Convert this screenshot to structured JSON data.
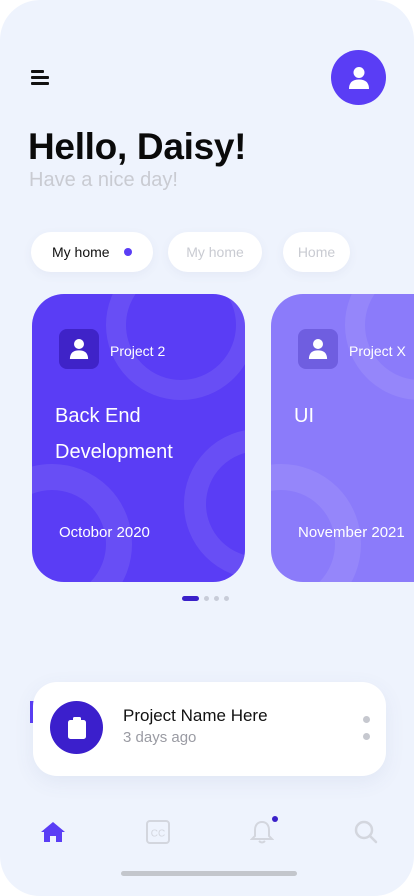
{
  "header": {
    "greeting": "Hello, Daisy!",
    "subtitle": "Have a nice day!",
    "menu_icon": "hamburger-menu-icon",
    "avatar_icon": "user-icon"
  },
  "chips": [
    {
      "label": "My home",
      "active": true
    },
    {
      "label": "My home",
      "active": false
    },
    {
      "label": "Home",
      "active": false
    }
  ],
  "cards": [
    {
      "project": "Project 2",
      "title_line1": "Back End",
      "title_line2": "Development",
      "date": "Octobor 2020",
      "color": "#5a3df5"
    },
    {
      "project": "Project X",
      "title_line1": "UI",
      "title_line2": "",
      "date": "November 2021",
      "color": "#8b7bfa"
    }
  ],
  "pager": {
    "total": 4,
    "active": 0
  },
  "recent": {
    "name": "Project Name Here",
    "time": "3 days ago",
    "icon": "clipboard-icon"
  },
  "bottom_nav": [
    {
      "icon": "home-icon",
      "active": true
    },
    {
      "icon": "cc-icon",
      "active": false
    },
    {
      "icon": "bell-icon",
      "active": false,
      "badge": true
    },
    {
      "icon": "search-icon",
      "active": false
    }
  ],
  "colors": {
    "accent": "#5a3df5",
    "accent_dark": "#3a20c9",
    "card2": "#8b7bfa",
    "background": "#eef3fd",
    "muted": "#c9cbd2"
  }
}
